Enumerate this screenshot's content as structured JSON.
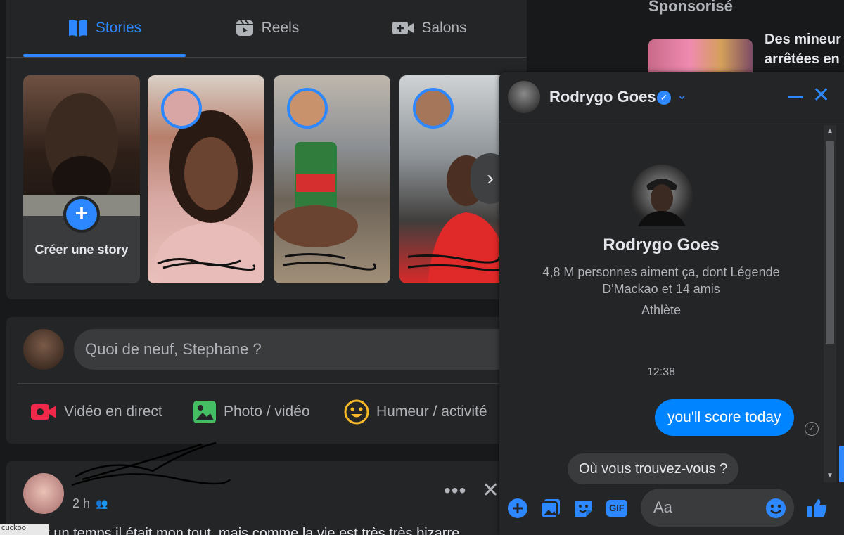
{
  "tabs": [
    {
      "label": "Stories",
      "icon": "book-icon",
      "active": true
    },
    {
      "label": "Reels",
      "icon": "reels-icon",
      "active": false
    },
    {
      "label": "Salons",
      "icon": "video-camera-icon",
      "active": false
    }
  ],
  "stories": {
    "create_label": "Créer une story",
    "create_plus": "+"
  },
  "composer": {
    "placeholder": "Quoi de neuf, Stephane ?",
    "actions": [
      {
        "label": "Vidéo en direct",
        "icon": "live-video-icon",
        "color": "#f02849"
      },
      {
        "label": "Photo / vidéo",
        "icon": "photo-icon",
        "color": "#45bd62"
      },
      {
        "label": "Humeur / activité",
        "icon": "smiley-icon",
        "color": "#f7b928"
      }
    ]
  },
  "post": {
    "time": "2 h",
    "text": "Il fut un temps il était mon tout, mais comme la vie est très très bizarre"
  },
  "cursor_tooltip": "cuckoo",
  "sponsored": {
    "title": "Sponsorisé",
    "ad_text_line1": "Des mineur",
    "ad_text_line2": "arrêtées en"
  },
  "chat": {
    "name": "Rodrygo Goes",
    "verified": "✓",
    "profile_name": "Rodrygo Goes",
    "likes_text": "4,8 M personnes aiment ça, dont Légende D'Mackao et 14 amis",
    "category": "Athlète",
    "time": "12:38",
    "outgoing_message": "you'll score today",
    "suggestion": "Où vous trouvez-vous ?",
    "input_placeholder": "Aa",
    "gif_label": "GIF"
  },
  "colors": {
    "accent": "#2d88ff",
    "message_bubble": "#0084ff",
    "background": "#18191a",
    "card": "#242526"
  }
}
